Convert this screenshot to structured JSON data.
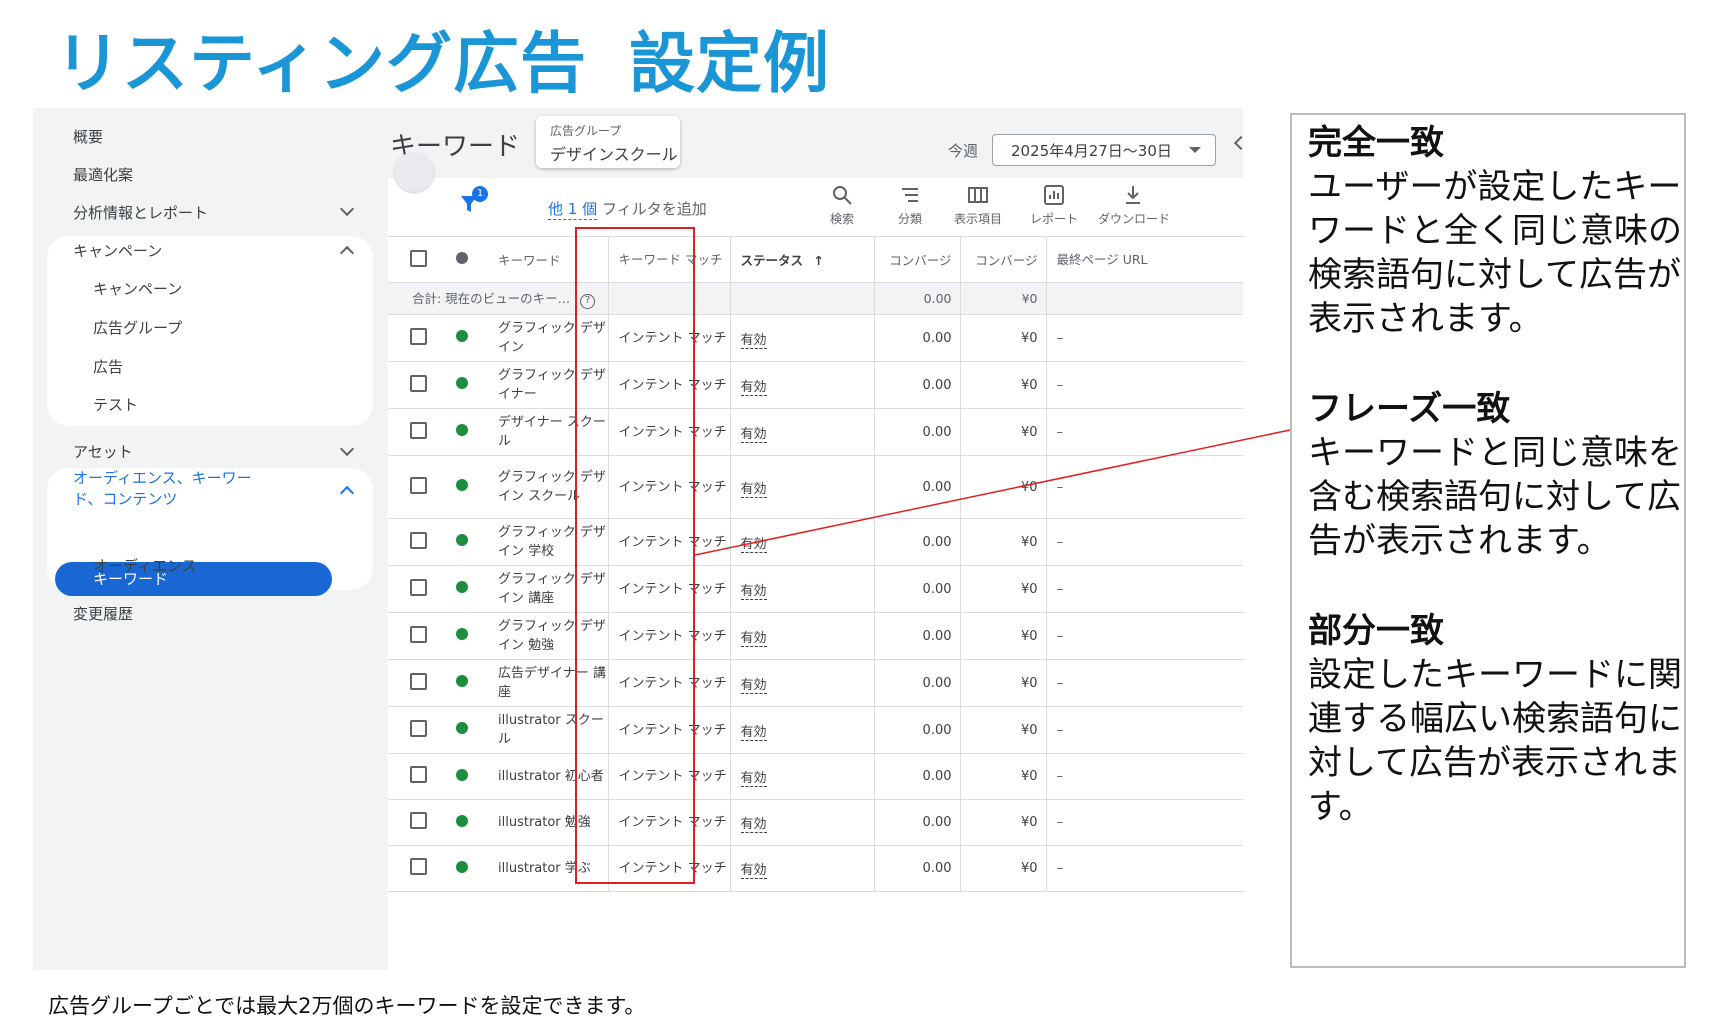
{
  "headline": {
    "part1": "リスティング広告",
    "part2": "設定例"
  },
  "sidebar": {
    "overview": "概要",
    "recommendations": "最適化案",
    "insights_reports": "分析情報とレポート",
    "campaigns_group": "キャンペーン",
    "campaigns_items": [
      "キャンペーン",
      "広告グループ",
      "広告",
      "テスト"
    ],
    "assets": "アセット",
    "audience_group": "オーディエンス、キーワード、コンテンツ",
    "audience_active": "キーワード",
    "audience_other": "オーディエンス",
    "change_history": "変更履歴"
  },
  "topbar": {
    "title": "キーワード",
    "adgroup_label": "広告グループ",
    "adgroup_value": "デザインスクール",
    "week_label": "今週",
    "date_range": "2025年4月27日〜30日"
  },
  "filterbar": {
    "badge": "1",
    "other": "他 1 個",
    "add_filter": "フィルタを追加",
    "tools": [
      "検索",
      "分類",
      "表示項目",
      "レポート",
      "ダウンロード"
    ]
  },
  "table": {
    "headers": {
      "keyword": "キーワード",
      "match": "キーワード マッチ",
      "status": "ステータス",
      "conv1": "コンバージ",
      "conv2": "コンバージ",
      "url": "最終ページ URL"
    },
    "total": {
      "label": "合計: 現在のビューのキー…",
      "conv": "0.00",
      "value": "¥0"
    },
    "rows": [
      {
        "keyword": "グラフィック デザイン",
        "match": "インテント マッチ",
        "status": "有効",
        "conv": "0.00",
        "value": "¥0",
        "url": "–"
      },
      {
        "keyword": "グラフィック デザイナー",
        "match": "インテント マッチ",
        "status": "有効",
        "conv": "0.00",
        "value": "¥0",
        "url": "–"
      },
      {
        "keyword": "デザイナー スクール",
        "match": "インテント マッチ",
        "status": "有効",
        "conv": "0.00",
        "value": "¥0",
        "url": "–"
      },
      {
        "keyword": "グラフィック デザイン スクール",
        "match": "インテント マッチ",
        "status": "有効",
        "conv": "0.00",
        "value": "¥0",
        "url": "–"
      },
      {
        "keyword": "グラフィック デザイン 学校",
        "match": "インテント マッチ",
        "status": "有効",
        "conv": "0.00",
        "value": "¥0",
        "url": "–"
      },
      {
        "keyword": "グラフィック デザイン 講座",
        "match": "インテント マッチ",
        "status": "有効",
        "conv": "0.00",
        "value": "¥0",
        "url": "–"
      },
      {
        "keyword": "グラフィック デザイン 勉強",
        "match": "インテント マッチ",
        "status": "有効",
        "conv": "0.00",
        "value": "¥0",
        "url": "–"
      },
      {
        "keyword": "広告デザイナー 講座",
        "match": "インテント マッチ",
        "status": "有効",
        "conv": "0.00",
        "value": "¥0",
        "url": "–"
      },
      {
        "keyword": "illustrator スクール",
        "match": "インテント マッチ",
        "status": "有効",
        "conv": "0.00",
        "value": "¥0",
        "url": "–"
      },
      {
        "keyword": "illustrator 初心者",
        "match": "インテント マッチ",
        "status": "有効",
        "conv": "0.00",
        "value": "¥0",
        "url": "–"
      },
      {
        "keyword": "illustrator 勉強",
        "match": "インテント マッチ",
        "status": "有効",
        "conv": "0.00",
        "value": "¥0",
        "url": "–"
      },
      {
        "keyword": "illustrator 学ぶ",
        "match": "インテント マッチ",
        "status": "有効",
        "conv": "0.00",
        "value": "¥0",
        "url": "–"
      }
    ]
  },
  "annotation": {
    "exact_title": "完全一致",
    "exact_body": "ユーザーが設定したキーワードと全く同じ意味の検索語句に対して広告が表示されます。",
    "phrase_title": "フレーズ一致",
    "phrase_body": "キーワードと同じ意味を含む検索語句に対して広告が表示されます。",
    "broad_title": "部分一致",
    "broad_body": "設定したキーワードに関連する幅広い検索語句に対して広告が表示されます。"
  },
  "footer": "広告グループごとでは最大2万個のキーワードを設定できます。",
  "colors": {
    "headline": "#1a96d6",
    "highlight": "#e02020",
    "active": "#1967d2",
    "status_green": "#1e8e3e"
  }
}
